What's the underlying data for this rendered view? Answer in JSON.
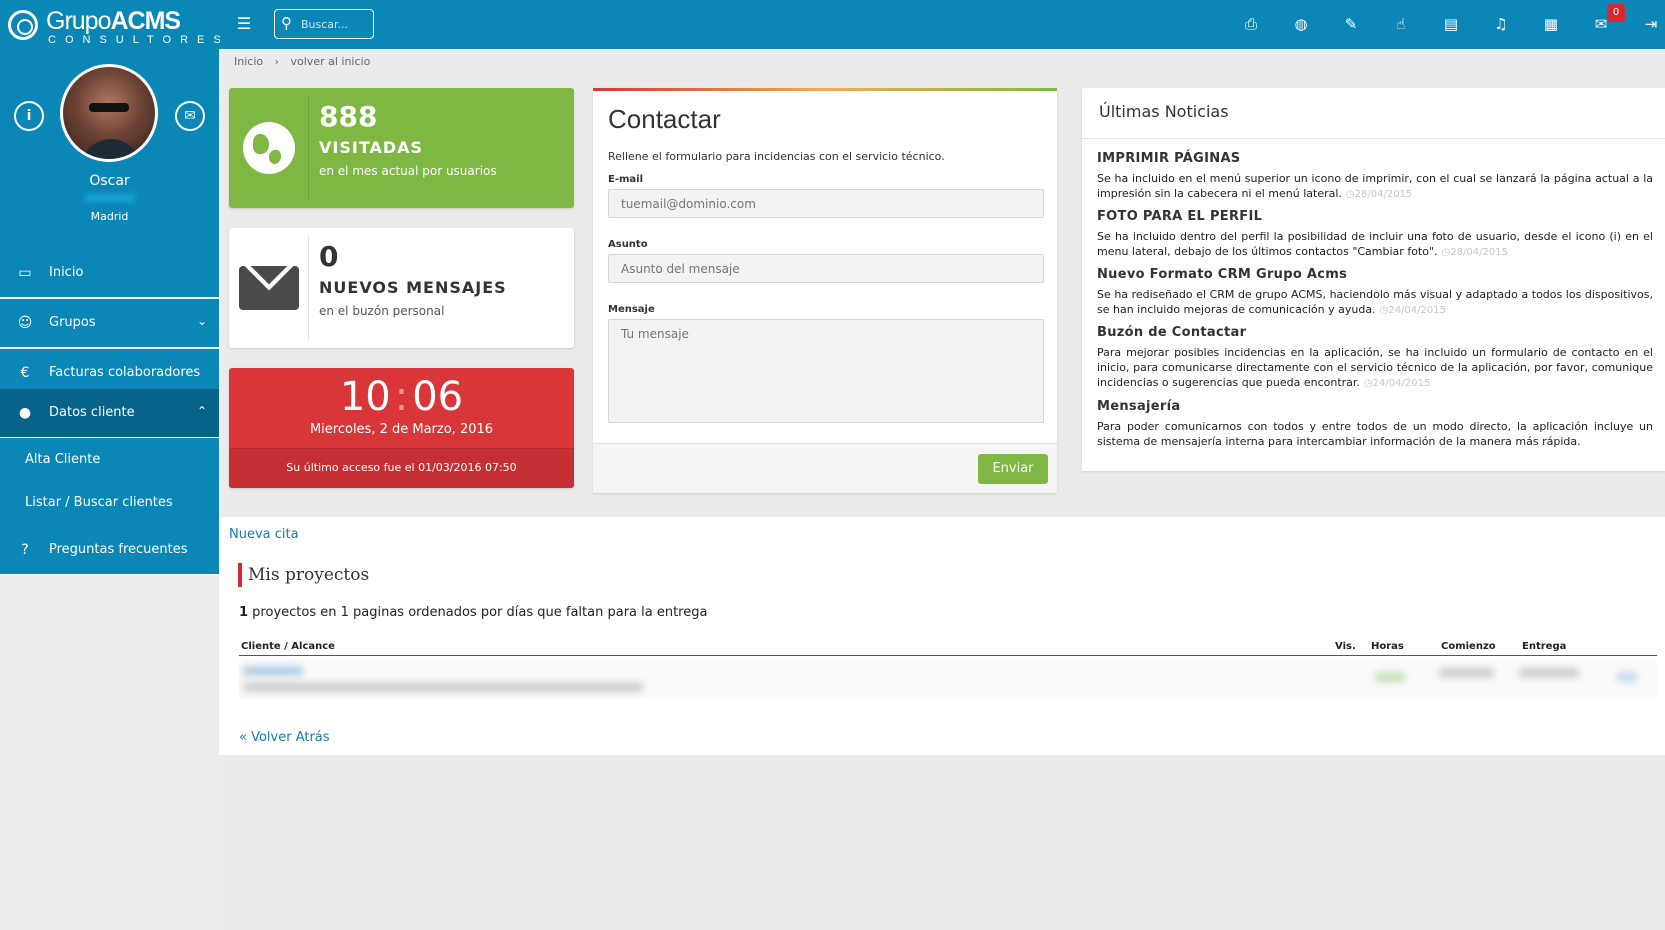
{
  "brand": {
    "name_light": "Grupo",
    "name_bold": "ACMS",
    "tagline": "CONSULTORES"
  },
  "search": {
    "placeholder": "Buscar..."
  },
  "topbar": {
    "icons": [
      "print-icon",
      "globe-icon",
      "wrench-icon",
      "thumbs-up-icon",
      "chart-icon",
      "bell-icon",
      "calendar-icon",
      "comments-icon",
      "logout-icon"
    ],
    "messages_badge": "0"
  },
  "profile": {
    "name": "Oscar",
    "city": "Madrid"
  },
  "sidebar": {
    "items": [
      {
        "label": "Inicio",
        "icon": "monitor-icon"
      },
      {
        "label": "Grupos",
        "icon": "users-icon"
      },
      {
        "label": "Facturas colaboradores",
        "icon": "euro-icon"
      },
      {
        "label": "Datos cliente",
        "icon": "user-icon"
      },
      {
        "label": "Preguntas frecuentes",
        "icon": "question-icon"
      }
    ],
    "subitems": [
      {
        "label": "Alta Cliente"
      },
      {
        "label": "Listar / Buscar clientes"
      }
    ]
  },
  "breadcrumb": {
    "home": "Inicio",
    "current": "volver al inicio"
  },
  "stats": {
    "visits": {
      "value": "888",
      "title": "VISITADAS",
      "subtitle": "en el mes actual por usuarios"
    },
    "messages": {
      "value": "0",
      "title": "NUEVOS MENSAJES",
      "subtitle": "en el buzón personal"
    },
    "clock": {
      "hours": "10",
      "minutes": "06",
      "date": "Miercoles, 2 de Marzo, 2016",
      "last_access": "Su último acceso fue el 01/03/2016 07:50"
    }
  },
  "contact": {
    "title": "Contactar",
    "description": "Rellene el formulario para incidencias con el servicio técnico.",
    "email_label": "E-mail",
    "email_placeholder": "tuemail@dominio.com",
    "subject_label": "Asunto",
    "subject_placeholder": "Asunto del mensaje",
    "message_label": "Mensaje",
    "message_placeholder": "Tu mensaje",
    "send_label": "Enviar"
  },
  "news": {
    "title": "Últimas Noticias",
    "items": [
      {
        "heading": "IMPRIMIR PÁGINAS",
        "text": "Se ha incluido en el menú superior un icono de imprimir, con el cual se lanzará la página actual a la impresión sin la cabecera ni el menú lateral.",
        "date": "28/04/2015"
      },
      {
        "heading": "FOTO PARA EL PERFIL",
        "text": "Se ha incluido dentro del perfil la posibilidad de incluir una foto de usuario, desde el icono (i) en el menu lateral, debajo de los últimos contactos \"Cambiar foto\".",
        "date": "28/04/2015"
      },
      {
        "heading": "Nuevo Formato CRM Grupo Acms",
        "text": "Se ha rediseñado el CRM de grupo ACMS, haciendolo más visual y adaptado a todos los dispositivos, se han incluido mejoras de comunicación y ayuda.",
        "date": "24/04/2015"
      },
      {
        "heading": "Buzón de Contactar",
        "text": "Para mejorar posibles incidencias en la aplicación, se ha incluido un formulario de contacto en el inicio, para comunicarse directamente con el servicio técnico de la aplicación, por favor, comunique incidencias o sugerencias que pueda encontrar.",
        "date": "24/04/2015"
      },
      {
        "heading": "Mensajería",
        "text": "Para poder comunicarnos con todos y entre todos de un modo directo, la aplicación incluye un sistema de mensajería interna para intercambiar información de la manera más rápida.",
        "date": ""
      }
    ]
  },
  "projects": {
    "new_appointment": "Nueva cita",
    "title": "Mis proyectos",
    "count": "1",
    "summary": " proyectos en 1 paginas ordenados por días que faltan para la entrega",
    "columns": [
      "Cliente / Alcance",
      "Vis.",
      "Horas",
      "Comienzo",
      "Entrega"
    ],
    "back_link": "« Volver Atrás"
  }
}
